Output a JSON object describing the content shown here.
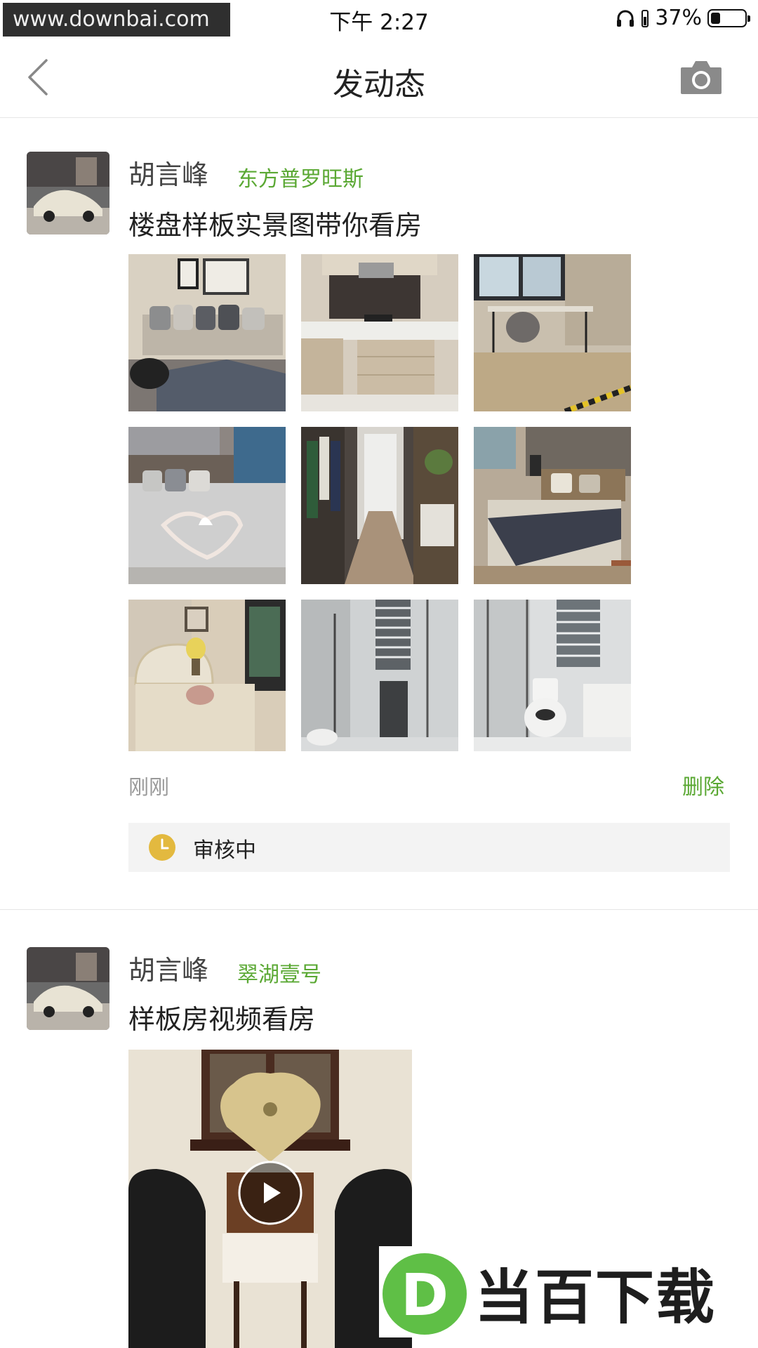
{
  "status_bar": {
    "watermark": "www.downbai.com",
    "time": "下午 2:27",
    "battery_percent": "37%",
    "battery_level": 0.37
  },
  "navbar": {
    "title": "发动态"
  },
  "posts": [
    {
      "author": "胡言峰",
      "project": "东方普罗旺斯",
      "text": "楼盘样板实景图带你看房",
      "time": "刚刚",
      "delete_label": "删除",
      "review_status": "审核中",
      "photos": [
        "living-room",
        "kitchen",
        "study",
        "bedroom-master",
        "walk-in-closet",
        "bedroom-second",
        "bedroom-kids",
        "shower-room",
        "bathroom"
      ]
    },
    {
      "author": "胡言峰",
      "project": "翠湖壹号",
      "text": "样板房视频看房"
    }
  ],
  "brand": {
    "text": "当百下载",
    "letter": "D"
  }
}
